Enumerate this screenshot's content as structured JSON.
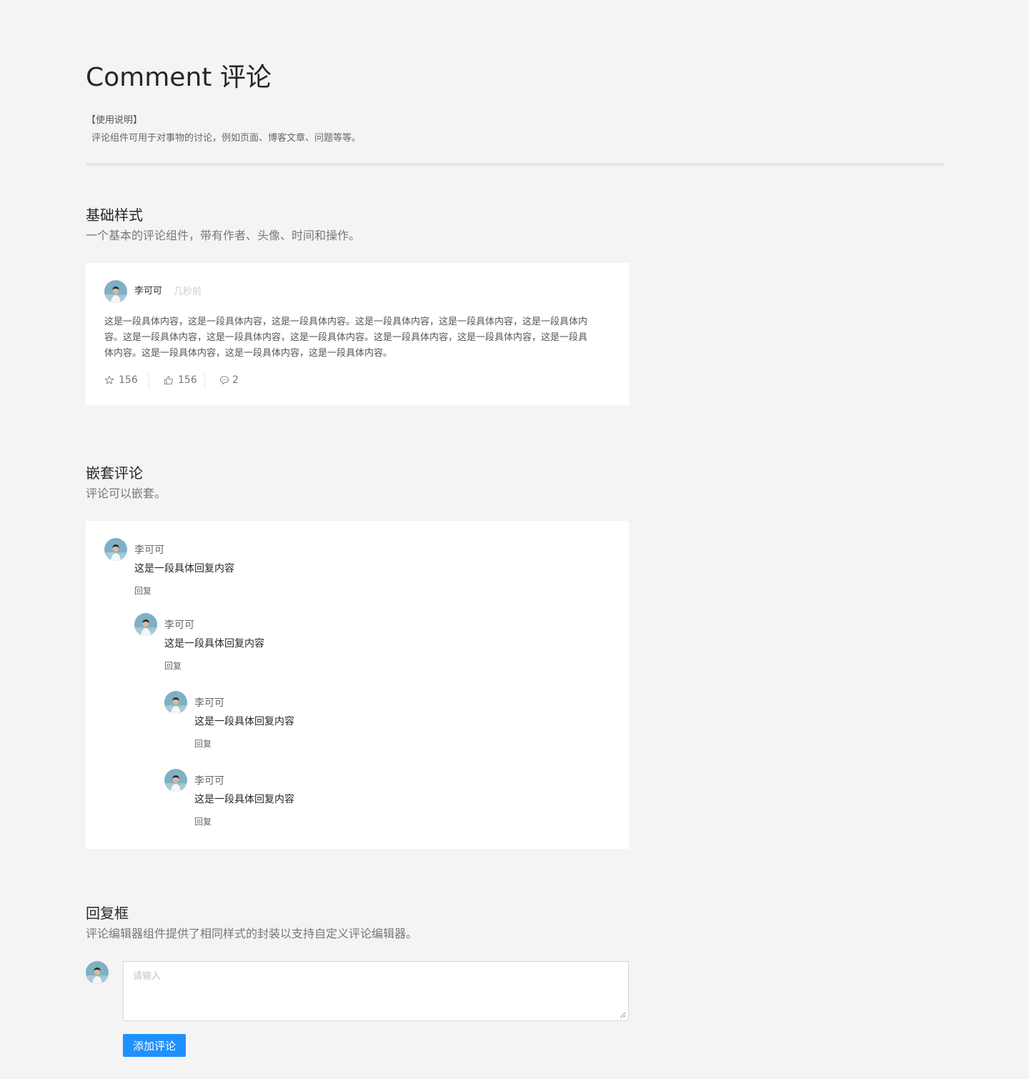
{
  "header": {
    "title": "Comment 评论",
    "usage_heading": "【使用说明】",
    "usage_text": "评论组件可用于对事物的讨论，例如页面、博客文章、问题等等。"
  },
  "basic": {
    "title": "基础样式",
    "description": "一个基本的评论组件，带有作者、头像、时间和操作。",
    "comment": {
      "author": "李可可",
      "time": "几秒前",
      "content": "这是一段具体内容，这是一段具体内容，这是一段具体内容。这是一段具体内容，这是一段具体内容，这是一段具体内容。这是一段具体内容，这是一段具体内容，这是一段具体内容。这是一段具体内容，这是一段具体内容，这是一段具体内容。这是一段具体内容，这是一段具体内容，这是一段具体内容。",
      "star_count": "156",
      "like_count": "156",
      "reply_count": "2"
    }
  },
  "nested": {
    "title": "嵌套评论",
    "description": "评论可以嵌套。",
    "comments": [
      {
        "author": "李可可",
        "content": "这是一段具体回复内容",
        "reply_label": "回复"
      },
      {
        "author": "李可可",
        "content": "这是一段具体回复内容",
        "reply_label": "回复"
      },
      {
        "author": "李可可",
        "content": "这是一段具体回复内容",
        "reply_label": "回复"
      },
      {
        "author": "李可可",
        "content": "这是一段具体回复内容",
        "reply_label": "回复"
      }
    ]
  },
  "editor": {
    "title": "回复框",
    "description": "评论编辑器组件提供了相同样式的封装以支持自定义评论编辑器。",
    "placeholder": "请输入",
    "submit_label": "添加评论"
  },
  "icons": {
    "star": "star-icon",
    "like": "thumbs-up-icon",
    "reply": "message-icon"
  },
  "colors": {
    "primary": "#1e90ff",
    "background": "#f4f4f4",
    "card": "#ffffff"
  }
}
